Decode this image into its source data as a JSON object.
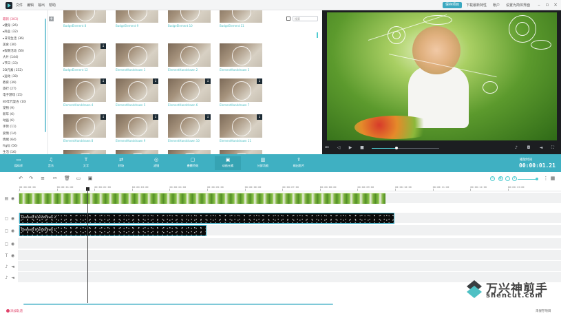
{
  "titlebar": {
    "menus": [
      "文件",
      "编辑",
      "输出",
      "帮助"
    ],
    "buy_label": "保存项目",
    "links": [
      "下载最新特性",
      "帐户",
      "设置为简体界面"
    ],
    "window_buttons": [
      "minimize-icon",
      "maximize-icon",
      "close-icon"
    ]
  },
  "categories": [
    {
      "label": "最新 (303)",
      "selected": true,
      "expandable": false
    },
    {
      "label": "▸健身 (26)",
      "selected": false
    },
    {
      "label": "▸商业 (32)",
      "selected": false
    },
    {
      "label": "▸日常生活 (36)",
      "selected": false
    },
    {
      "label": "美食 (30)",
      "selected": false
    },
    {
      "label": "▸假期活动 (56)",
      "selected": false
    },
    {
      "label": "大片 (144)",
      "selected": false
    },
    {
      "label": "▸节日 (33)",
      "selected": false
    },
    {
      "label": "2D元素 (152)",
      "selected": false
    },
    {
      "label": "▸运动 (38)",
      "selected": false
    },
    {
      "label": "教育 (39)",
      "selected": false
    },
    {
      "label": "旅行 (27)",
      "selected": false
    },
    {
      "label": "电子游戏 (15)",
      "selected": false
    },
    {
      "label": "80年代复古 (10)",
      "selected": false
    },
    {
      "label": "宠物 (9)",
      "selected": false
    },
    {
      "label": "新年 (6)",
      "selected": false
    },
    {
      "label": "动画 (6)",
      "selected": false
    },
    {
      "label": "手势 (11)",
      "selected": false
    },
    {
      "label": "爱情 (14)",
      "selected": false
    },
    {
      "label": "情绪 (64)",
      "selected": false
    },
    {
      "label": "Fig标 (56)",
      "selected": false
    },
    {
      "label": "生活 (16)",
      "selected": false
    }
  ],
  "media": {
    "search_placeholder": "搜索",
    "rows": [
      [
        "BadgeElement 8",
        "BadgeElement 9",
        "BadgeElement 10",
        "BadgeElement 11"
      ],
      [
        "BadgeElement 12",
        "ElementHanddrawn 1",
        "ElementHanddrawn 2",
        "ElementHanddrawn 3"
      ],
      [
        "ElementHanddrawn 4",
        "ElementHanddrawn 5",
        "ElementHanddrawn 6",
        "ElementHanddrawn 7"
      ],
      [
        "ElementHanddrawn 8",
        "ElementHanddrawn 9",
        "ElementHanddrawn 10",
        "ElementHanddrawn 11"
      ]
    ]
  },
  "toolbar": {
    "tools": [
      {
        "label": "媒体库",
        "icon": "folder-icon"
      },
      {
        "label": "音乐",
        "icon": "music-icon"
      },
      {
        "label": "文字",
        "icon": "text-icon"
      },
      {
        "label": "转场",
        "icon": "transition-icon"
      },
      {
        "label": "滤镜",
        "icon": "filter-icon"
      },
      {
        "label": "叠覆特效",
        "icon": "overlay-icon"
      },
      {
        "label": "动画元素",
        "icon": "elements-icon"
      },
      {
        "label": "分屏功能",
        "icon": "splitscreen-icon"
      },
      {
        "label": "输出影片",
        "icon": "export-icon"
      }
    ],
    "timecode_label": "播放时间",
    "timecode": "00:00:01.21"
  },
  "ruler": [
    "00:00:00:00",
    "00:00:01:00",
    "00:00:02:00",
    "00:00:03:00",
    "00:00:04:00",
    "00:00:05:00",
    "00:00:06:00",
    "00:00:07:00",
    "00:00:08:00",
    "00:00:09:00",
    "00:00:10:00",
    "00:00:11:00",
    "00:00:12:00",
    "00:00:13:00"
  ],
  "timeline": {
    "clip_element_2": "Element Handdrawn 2",
    "clip_element_1": "Element Handdrawn 1",
    "hint": "添加轨道",
    "status": "未保存项目"
  },
  "watermark": {
    "cn": "万兴神剪手",
    "url": "shencut.com"
  }
}
